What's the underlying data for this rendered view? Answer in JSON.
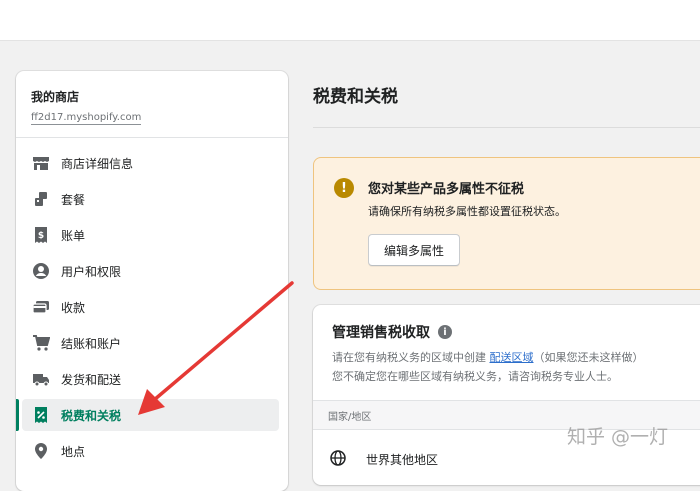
{
  "store": {
    "name": "我的商店",
    "domain": "ff2d17.myshopify.com"
  },
  "sidebar": {
    "items": [
      {
        "label": "商店详细信息",
        "icon": "store-icon",
        "active": false
      },
      {
        "label": "套餐",
        "icon": "plan-icon",
        "active": false
      },
      {
        "label": "账单",
        "icon": "billing-icon",
        "active": false
      },
      {
        "label": "用户和权限",
        "icon": "user-icon",
        "active": false
      },
      {
        "label": "收款",
        "icon": "payment-icon",
        "active": false
      },
      {
        "label": "结账和账户",
        "icon": "cart-icon",
        "active": false
      },
      {
        "label": "发货和配送",
        "icon": "truck-icon",
        "active": false
      },
      {
        "label": "税费和关税",
        "icon": "tax-icon",
        "active": true
      },
      {
        "label": "地点",
        "icon": "location-icon",
        "active": false
      }
    ]
  },
  "page": {
    "title": "税费和关税"
  },
  "banner": {
    "title": "您对某些产品多属性不征税",
    "text": "请确保所有纳税多属性都设置征税状态。",
    "button": "编辑多属性"
  },
  "sales_tax": {
    "title": "管理销售税收取",
    "line1_before": "请在您有纳税义务的区域中创建 ",
    "line1_link": "配送区域",
    "line1_after": "（如果您还未这样做）",
    "line2": "您不确定您在哪些区域有纳税义务，请咨询税务专业人士。",
    "column_header": "国家/地区",
    "rows": [
      {
        "label": "世界其他地区"
      }
    ]
  },
  "watermark": "知乎 @一灯",
  "colors": {
    "accent": "#008060",
    "link": "#2c6ecb",
    "warning_bg": "#fdf1e0",
    "warning_icon": "#b98900",
    "annotation_arrow": "#e53935"
  }
}
